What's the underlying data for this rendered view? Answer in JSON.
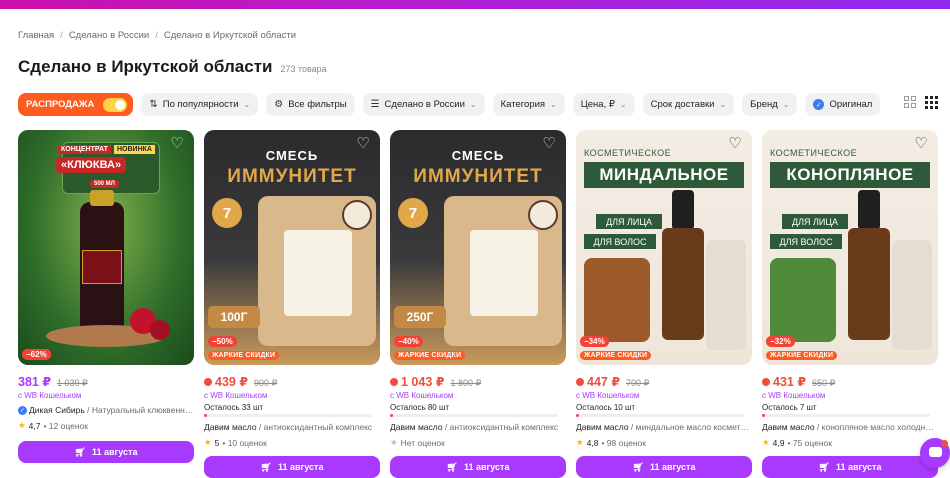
{
  "breadcrumbs": [
    "Главная",
    "Сделано в России",
    "Сделано в Иркутской области"
  ],
  "page": {
    "title": "Сделано в Иркутской области",
    "count": "273 товара"
  },
  "filters": {
    "sale": "РАСПРОДАЖА",
    "sort": "По популярности",
    "all_filters": "Все фильтры",
    "made_in": "Сделано в России",
    "category": "Категория",
    "price": "Цена, ₽",
    "delivery": "Срок доставки",
    "brand": "Бренд",
    "original": "Оригинал"
  },
  "colors": {
    "accent": "#a73afd",
    "sale": "#ff5a1f",
    "price": "#f24c3c",
    "brand_gradient": "#cb11ab"
  },
  "products": [
    {
      "discount": "−62%",
      "hot": "",
      "img_title": "«КЛЮКВА»",
      "img_sub1": "КОНЦЕНТРАТ",
      "img_sub2": "НОВИНКА",
      "img_sub3": "500 МЛ",
      "price": "381 ₽",
      "old_price": "1 039 ₽",
      "wallet": "с WB Кошельком",
      "stock": "",
      "brand": "Дикая Сибирь",
      "name": " / Натуральный клюквенный концентрат",
      "rating": "4,7",
      "reviews": "• 12 оценок",
      "buy": "11 августа",
      "heart_icon": "heart-outline"
    },
    {
      "discount": "−50%",
      "hot": "ЖАРКИЕ СКИДКИ",
      "img_title": "СМЕСЬ",
      "img_sub1": "ИММУНИТЕТ",
      "img_sub2": "100Г",
      "img_sub3": "7",
      "price": "439 ₽",
      "old_price": "900 ₽",
      "wallet": "с WB Кошельком",
      "stock": "Осталось 33 шт",
      "brand": "Давим масло",
      "name": " / антиоксидантный комплекс",
      "rating": "5",
      "reviews": "• 10 оценок",
      "buy": "11 августа",
      "heart_icon": "heart-outline"
    },
    {
      "discount": "−40%",
      "hot": "ЖАРКИЕ СКИДКИ",
      "img_title": "СМЕСЬ",
      "img_sub1": "ИММУНИТЕТ",
      "img_sub2": "250Г",
      "img_sub3": "7",
      "price": "1 043 ₽",
      "old_price": "1 800 ₽",
      "wallet": "с WB Кошельком",
      "stock": "Осталось 80 шт",
      "brand": "Давим масло",
      "name": " / антиоксидантный комплекс",
      "rating": "",
      "reviews": "Нет оценок",
      "buy": "11 августа",
      "heart_icon": "heart-outline"
    },
    {
      "discount": "−34%",
      "hot": "ЖАРКИЕ СКИДКИ",
      "img_title": "КОСМЕТИЧЕСКОЕ",
      "img_sub1": "МИНДАЛЬНОЕ",
      "img_sub2": "ДЛЯ ЛИЦА",
      "img_sub3": "ДЛЯ ВОЛОС",
      "price": "447 ₽",
      "old_price": "700 ₽",
      "wallet": "с WB Кошельком",
      "stock": "Осталось 10 шт",
      "brand": "Давим масло",
      "name": " / миндальное масло косметическое",
      "rating": "4,8",
      "reviews": "• 98 оценок",
      "buy": "11 августа",
      "heart_icon": "heart-outline"
    },
    {
      "discount": "−32%",
      "hot": "ЖАРКИЕ СКИДКИ",
      "img_title": "КОСМЕТИЧЕСКОЕ",
      "img_sub1": "КОНОПЛЯНОЕ",
      "img_sub2": "ДЛЯ ЛИЦА",
      "img_sub3": "ДЛЯ ВОЛОС",
      "price": "431 ₽",
      "old_price": "650 ₽",
      "wallet": "с WB Кошельком",
      "stock": "Осталось 7 шт",
      "brand": "Давим масло",
      "name": " / конопляное масло холодного отжима",
      "rating": "4,9",
      "reviews": "• 75 оценок",
      "buy": "11 августа",
      "heart_icon": "heart-outline"
    }
  ]
}
